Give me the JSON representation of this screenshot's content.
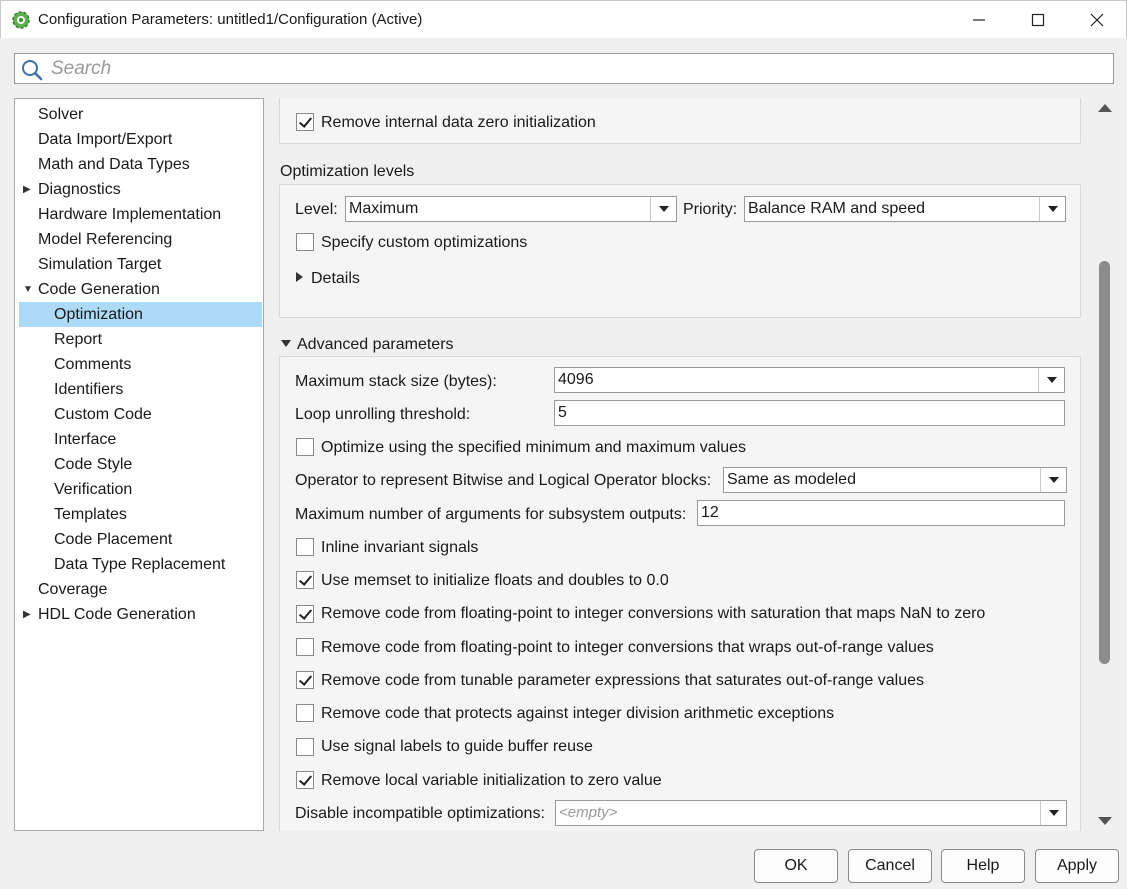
{
  "window": {
    "title": "Configuration Parameters: untitled1/Configuration (Active)",
    "app_icon": "simulink-gear-icon",
    "controls": [
      "minimize-icon",
      "maximize-icon",
      "close-icon"
    ]
  },
  "search": {
    "placeholder": "Search",
    "value": ""
  },
  "tree": {
    "items": [
      {
        "label": "Solver",
        "level": 0,
        "expander": "none"
      },
      {
        "label": "Data Import/Export",
        "level": 0,
        "expander": "none"
      },
      {
        "label": "Math and Data Types",
        "level": 0,
        "expander": "none"
      },
      {
        "label": "Diagnostics",
        "level": 0,
        "expander": "collapsed"
      },
      {
        "label": "Hardware Implementation",
        "level": 0,
        "expander": "none"
      },
      {
        "label": "Model Referencing",
        "level": 0,
        "expander": "none"
      },
      {
        "label": "Simulation Target",
        "level": 0,
        "expander": "none"
      },
      {
        "label": "Code Generation",
        "level": 0,
        "expander": "expanded"
      },
      {
        "label": "Optimization",
        "level": 1,
        "expander": "none",
        "selected": true
      },
      {
        "label": "Report",
        "level": 1,
        "expander": "none"
      },
      {
        "label": "Comments",
        "level": 1,
        "expander": "none"
      },
      {
        "label": "Identifiers",
        "level": 1,
        "expander": "none"
      },
      {
        "label": "Custom Code",
        "level": 1,
        "expander": "none"
      },
      {
        "label": "Interface",
        "level": 1,
        "expander": "none"
      },
      {
        "label": "Code Style",
        "level": 1,
        "expander": "none"
      },
      {
        "label": "Verification",
        "level": 1,
        "expander": "none"
      },
      {
        "label": "Templates",
        "level": 1,
        "expander": "none"
      },
      {
        "label": "Code Placement",
        "level": 1,
        "expander": "none"
      },
      {
        "label": "Data Type Replacement",
        "level": 1,
        "expander": "none"
      },
      {
        "label": "Coverage",
        "level": 0,
        "expander": "none"
      },
      {
        "label": "HDL Code Generation",
        "level": 0,
        "expander": "collapsed"
      }
    ]
  },
  "top_section": {
    "remove_zero_init": {
      "label": "Remove internal data zero initialization",
      "checked": true
    }
  },
  "optimization_levels": {
    "title": "Optimization levels",
    "level_label": "Level:",
    "level_value": "Maximum",
    "priority_label": "Priority:",
    "priority_value": "Balance RAM and speed",
    "custom_opt": {
      "label": "Specify custom optimizations",
      "checked": false
    },
    "details_label": "Details"
  },
  "advanced": {
    "title": "Advanced parameters",
    "max_stack_label": "Maximum stack size (bytes):",
    "max_stack_value": "4096",
    "loop_unroll_label": "Loop unrolling threshold:",
    "loop_unroll_value": "5",
    "opt_minmax": {
      "label": "Optimize using the specified minimum and maximum values",
      "checked": false
    },
    "bitwise_label": "Operator to represent Bitwise and Logical Operator blocks:",
    "bitwise_value": "Same as modeled",
    "max_args_label": "Maximum number of arguments for subsystem outputs:",
    "max_args_value": "12",
    "inline_invariant": {
      "label": "Inline invariant signals",
      "checked": false
    },
    "memset": {
      "label": "Use memset to initialize floats and doubles to 0.0",
      "checked": true
    },
    "nan_saturation": {
      "label": "Remove code from floating-point to integer conversions with saturation that maps NaN to zero",
      "checked": true
    },
    "wraps": {
      "label": "Remove code from floating-point to integer conversions that wraps out-of-range values",
      "checked": false
    },
    "tunable": {
      "label": "Remove code from tunable parameter expressions that saturates out-of-range values",
      "checked": true
    },
    "div_exceptions": {
      "label": "Remove code that protects against integer division arithmetic exceptions",
      "checked": false
    },
    "signal_labels": {
      "label": "Use signal labels to guide buffer reuse",
      "checked": false
    },
    "local_var_init": {
      "label": "Remove local variable initialization to zero value",
      "checked": true
    },
    "disable_incompat_label": "Disable incompatible optimizations:",
    "disable_incompat_value": "<empty>"
  },
  "buttons": {
    "ok": "OK",
    "cancel": "Cancel",
    "help": "Help",
    "apply": "Apply"
  }
}
